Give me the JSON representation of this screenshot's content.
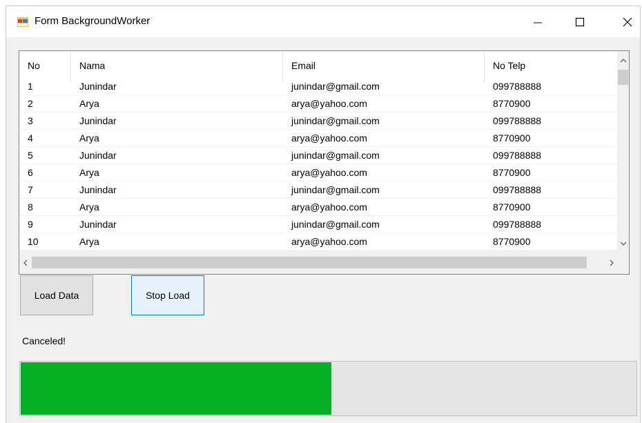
{
  "window": {
    "title": "Form BackgroundWorker",
    "icons": {
      "app": "app-form-icon",
      "minimize": "minimize-icon",
      "maximize": "maximize-icon",
      "close": "close-icon"
    }
  },
  "grid": {
    "columns": [
      "No",
      "Nama",
      "Email",
      "No Telp"
    ],
    "rows": [
      [
        "1",
        "Junindar",
        "junindar@gmail.com",
        "099788888"
      ],
      [
        "2",
        "Arya",
        "arya@yahoo.com",
        "8770900"
      ],
      [
        "3",
        "Junindar",
        "junindar@gmail.com",
        "099788888"
      ],
      [
        "4",
        "Arya",
        "arya@yahoo.com",
        "8770900"
      ],
      [
        "5",
        "Junindar",
        "junindar@gmail.com",
        "099788888"
      ],
      [
        "6",
        "Arya",
        "arya@yahoo.com",
        "8770900"
      ],
      [
        "7",
        "Junindar",
        "junindar@gmail.com",
        "099788888"
      ],
      [
        "8",
        "Arya",
        "arya@yahoo.com",
        "8770900"
      ],
      [
        "9",
        "Junindar",
        "junindar@gmail.com",
        "099788888"
      ],
      [
        "10",
        "Arya",
        "arya@yahoo.com",
        "8770900"
      ]
    ]
  },
  "buttons": {
    "load_label": "Load Data",
    "stop_label": "Stop Load"
  },
  "status_text": "Canceled!",
  "progress": {
    "fraction": 0.505,
    "color": "#06b025"
  }
}
